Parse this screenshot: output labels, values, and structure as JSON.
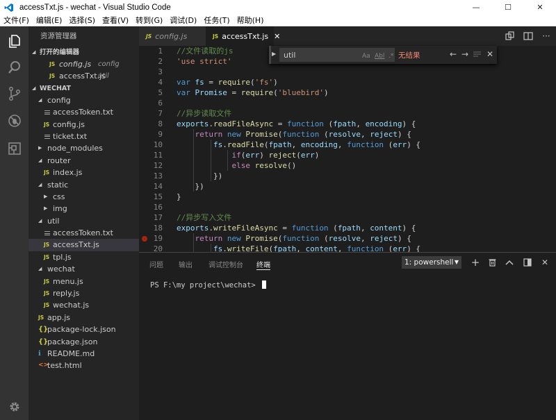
{
  "window": {
    "title": "accessTxt.js - wechat - Visual Studio Code",
    "minimize_glyph": "—",
    "maximize_glyph": "☐",
    "close_glyph": "✕"
  },
  "menu": [
    "文件(F)",
    "编辑(E)",
    "选择(S)",
    "查看(V)",
    "转到(G)",
    "调试(D)",
    "任务(T)",
    "帮助(H)"
  ],
  "activity_icons": [
    "files-icon",
    "search-icon",
    "source-control-icon",
    "debug-icon",
    "extensions-icon",
    "settings-gear-icon"
  ],
  "sidebar": {
    "title": "资源管理器",
    "open_editors": {
      "label": "打开的编辑器",
      "items": [
        {
          "name": "config.js",
          "desc": "config",
          "italic": true
        },
        {
          "name": "accessTxt.js",
          "desc": "util",
          "italic": false
        }
      ]
    },
    "project": {
      "label": "WECHAT",
      "tree": [
        {
          "label": "config",
          "type": "folder",
          "expanded": true,
          "depth": 1
        },
        {
          "label": "accessToken.txt",
          "type": "txt",
          "depth": 2
        },
        {
          "label": "config.js",
          "type": "js",
          "depth": 2
        },
        {
          "label": "ticket.txt",
          "type": "txt",
          "depth": 2
        },
        {
          "label": "node_modules",
          "type": "folder",
          "expanded": false,
          "depth": 1
        },
        {
          "label": "router",
          "type": "folder",
          "expanded": true,
          "depth": 1
        },
        {
          "label": "index.js",
          "type": "js",
          "depth": 2
        },
        {
          "label": "static",
          "type": "folder",
          "expanded": true,
          "depth": 1
        },
        {
          "label": "css",
          "type": "folder",
          "expanded": false,
          "depth": 2
        },
        {
          "label": "img",
          "type": "folder",
          "expanded": false,
          "depth": 2
        },
        {
          "label": "util",
          "type": "folder",
          "expanded": true,
          "depth": 1
        },
        {
          "label": "accessToken.txt",
          "type": "txt",
          "depth": 2
        },
        {
          "label": "accessTxt.js",
          "type": "js",
          "depth": 2,
          "selected": true
        },
        {
          "label": "tpl.js",
          "type": "js",
          "depth": 2
        },
        {
          "label": "wechat",
          "type": "folder",
          "expanded": true,
          "depth": 1
        },
        {
          "label": "menu.js",
          "type": "js",
          "depth": 2
        },
        {
          "label": "reply.js",
          "type": "js",
          "depth": 2
        },
        {
          "label": "wechat.js",
          "type": "js",
          "depth": 2
        },
        {
          "label": "app.js",
          "type": "js",
          "depth": 1
        },
        {
          "label": "package-lock.json",
          "type": "json",
          "depth": 1
        },
        {
          "label": "package.json",
          "type": "json",
          "depth": 1
        },
        {
          "label": "README.md",
          "type": "md",
          "depth": 1
        },
        {
          "label": "test.html",
          "type": "html",
          "depth": 1
        }
      ]
    }
  },
  "tabs": [
    {
      "label": "config.js",
      "active": false
    },
    {
      "label": "accessTxt.js",
      "active": true
    }
  ],
  "editor": {
    "lines": [
      {
        "n": "1",
        "tokens": [
          [
            "com",
            "//文件读取的js"
          ]
        ]
      },
      {
        "n": "2",
        "tokens": [
          [
            "str",
            "'use strict'"
          ]
        ]
      },
      {
        "n": "3",
        "tokens": []
      },
      {
        "n": "4",
        "tokens": [
          [
            "kw",
            "var "
          ],
          [
            "var",
            "fs"
          ],
          [
            "txt",
            " = "
          ],
          [
            "fn",
            "require"
          ],
          [
            "txt",
            "("
          ],
          [
            "str",
            "'fs'"
          ],
          [
            "txt",
            ")"
          ]
        ]
      },
      {
        "n": "5",
        "tokens": [
          [
            "kw",
            "var "
          ],
          [
            "var",
            "Promise"
          ],
          [
            "txt",
            " = "
          ],
          [
            "fn",
            "require"
          ],
          [
            "txt",
            "("
          ],
          [
            "str",
            "'bluebird'"
          ],
          [
            "txt",
            ")"
          ]
        ]
      },
      {
        "n": "6",
        "tokens": []
      },
      {
        "n": "7",
        "tokens": [
          [
            "com",
            "//异步读取文件"
          ]
        ]
      },
      {
        "n": "8",
        "tokens": [
          [
            "var",
            "exports"
          ],
          [
            "txt",
            "."
          ],
          [
            "fn",
            "readFileAsync"
          ],
          [
            "txt",
            " = "
          ],
          [
            "kw",
            "function"
          ],
          [
            "txt",
            " ("
          ],
          [
            "var",
            "fpath"
          ],
          [
            "txt",
            ", "
          ],
          [
            "var",
            "encoding"
          ],
          [
            "txt",
            ") {"
          ]
        ]
      },
      {
        "n": "9",
        "tokens": [
          [
            "txt",
            "    "
          ],
          [
            "ctl",
            "return"
          ],
          [
            "txt",
            " "
          ],
          [
            "kw",
            "new "
          ],
          [
            "fn",
            "Promise"
          ],
          [
            "txt",
            "("
          ],
          [
            "kw",
            "function"
          ],
          [
            "txt",
            " ("
          ],
          [
            "var",
            "resolve"
          ],
          [
            "txt",
            ", "
          ],
          [
            "var",
            "reject"
          ],
          [
            "txt",
            ") {"
          ]
        ]
      },
      {
        "n": "10",
        "tokens": [
          [
            "txt",
            "        "
          ],
          [
            "var",
            "fs"
          ],
          [
            "txt",
            "."
          ],
          [
            "fn",
            "readFile"
          ],
          [
            "txt",
            "("
          ],
          [
            "var",
            "fpath"
          ],
          [
            "txt",
            ", "
          ],
          [
            "var",
            "encoding"
          ],
          [
            "txt",
            ", "
          ],
          [
            "kw",
            "function"
          ],
          [
            "txt",
            " ("
          ],
          [
            "var",
            "err"
          ],
          [
            "txt",
            ") {"
          ]
        ]
      },
      {
        "n": "11",
        "tokens": [
          [
            "txt",
            "            "
          ],
          [
            "ctl",
            "if"
          ],
          [
            "txt",
            "("
          ],
          [
            "var",
            "err"
          ],
          [
            "txt",
            ") "
          ],
          [
            "fn",
            "reject"
          ],
          [
            "txt",
            "("
          ],
          [
            "var",
            "err"
          ],
          [
            "txt",
            ")"
          ]
        ]
      },
      {
        "n": "12",
        "tokens": [
          [
            "txt",
            "            "
          ],
          [
            "ctl",
            "else"
          ],
          [
            "txt",
            " "
          ],
          [
            "fn",
            "resolve"
          ],
          [
            "txt",
            "()"
          ]
        ]
      },
      {
        "n": "13",
        "tokens": [
          [
            "txt",
            "        })"
          ]
        ]
      },
      {
        "n": "14",
        "tokens": [
          [
            "txt",
            "    })"
          ]
        ]
      },
      {
        "n": "15",
        "tokens": [
          [
            "txt",
            "}"
          ]
        ]
      },
      {
        "n": "16",
        "tokens": []
      },
      {
        "n": "17",
        "tokens": [
          [
            "com",
            "//异步写入文件"
          ]
        ]
      },
      {
        "n": "18",
        "tokens": [
          [
            "var",
            "exports"
          ],
          [
            "txt",
            "."
          ],
          [
            "fn",
            "writeFileAsync"
          ],
          [
            "txt",
            " = "
          ],
          [
            "kw",
            "function"
          ],
          [
            "txt",
            " ("
          ],
          [
            "var",
            "fpath"
          ],
          [
            "txt",
            ", "
          ],
          [
            "var",
            "content"
          ],
          [
            "txt",
            ") {"
          ]
        ]
      },
      {
        "n": "19",
        "tokens": [
          [
            "txt",
            "    "
          ],
          [
            "ctl",
            "return"
          ],
          [
            "txt",
            " "
          ],
          [
            "kw",
            "new "
          ],
          [
            "fn",
            "Promise"
          ],
          [
            "txt",
            "("
          ],
          [
            "kw",
            "function"
          ],
          [
            "txt",
            " ("
          ],
          [
            "var",
            "resolve"
          ],
          [
            "txt",
            ", "
          ],
          [
            "var",
            "reject"
          ],
          [
            "txt",
            ") {"
          ]
        ],
        "breakpoint": true
      },
      {
        "n": "20",
        "tokens": [
          [
            "txt",
            "        "
          ],
          [
            "var",
            "fs"
          ],
          [
            "txt",
            "."
          ],
          [
            "fn",
            "writeFile"
          ],
          [
            "txt",
            "("
          ],
          [
            "var",
            "fpath"
          ],
          [
            "txt",
            ", "
          ],
          [
            "var",
            "content"
          ],
          [
            "txt",
            ", "
          ],
          [
            "kw",
            "function"
          ],
          [
            "txt",
            " ("
          ],
          [
            "var",
            "err"
          ],
          [
            "txt",
            ") {"
          ]
        ]
      }
    ]
  },
  "find_widget": {
    "query": "util",
    "match_case": "Aa",
    "whole_word": "Abl",
    "regex": ".*",
    "result": "无结果"
  },
  "panel": {
    "tabs": [
      {
        "label": "问题",
        "active": false
      },
      {
        "label": "输出",
        "active": false
      },
      {
        "label": "调试控制台",
        "active": false
      },
      {
        "label": "终端",
        "active": true
      }
    ],
    "terminal_select": "1: powershell",
    "prompt": "PS F:\\my project\\wechat> "
  },
  "colors": {
    "activity_bar": "#333333",
    "sidebar": "#252526",
    "editor": "#1e1e1e",
    "comment": "#608b4e",
    "string": "#ce9178",
    "keyword": "#569cd6",
    "variable": "#9cdcfe",
    "function": "#dcdcaa",
    "breakpoint": "#a1260d"
  }
}
